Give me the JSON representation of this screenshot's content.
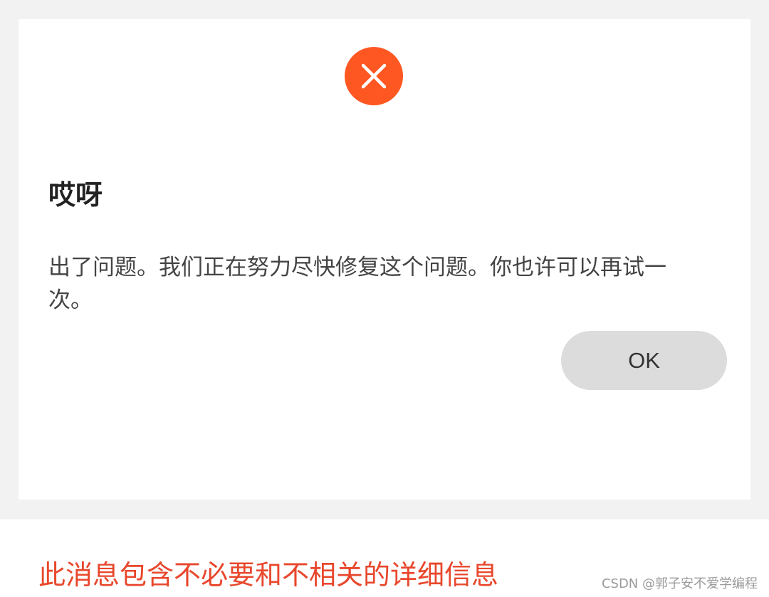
{
  "dialog": {
    "icon": "close-icon",
    "icon_color": "#fe5722",
    "title": "哎呀",
    "message": "出了问题。我们正在努力尽快修复这个问题。你也许可以再试一次。",
    "ok_label": "OK"
  },
  "annotation": {
    "text": "此消息包含不必要和不相关的详细信息",
    "color": "#e8472c"
  },
  "watermark": {
    "text": "CSDN @郭子安不爱学编程"
  }
}
